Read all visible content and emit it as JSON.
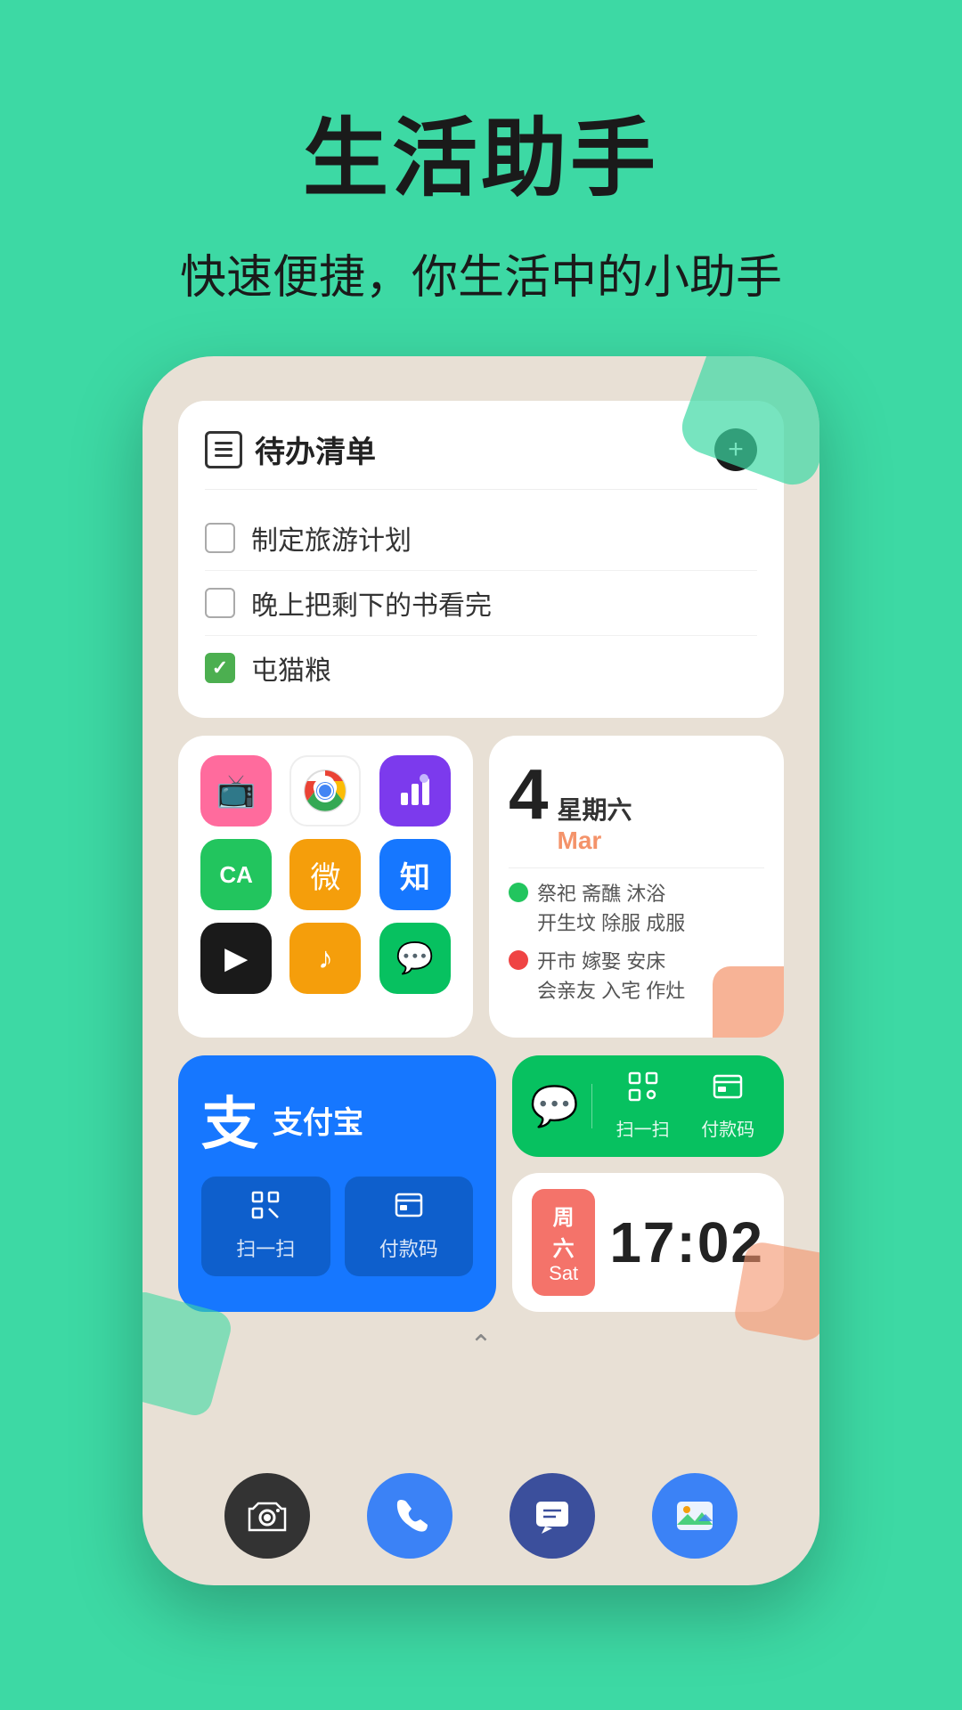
{
  "header": {
    "title": "生活助手",
    "subtitle": "快速便捷，你生活中的小助手"
  },
  "todo": {
    "title": "待办清单",
    "items": [
      {
        "text": "制定旅游计划",
        "checked": false
      },
      {
        "text": "晚上把剩下的书看完",
        "checked": false
      },
      {
        "text": "屯猫粮",
        "checked": true
      }
    ]
  },
  "apps": [
    {
      "name": "TV",
      "color": "pink",
      "emoji": "📺"
    },
    {
      "name": "Chrome",
      "color": "chrome",
      "emoji": ""
    },
    {
      "name": "Analytics",
      "color": "purple",
      "emoji": "📊"
    },
    {
      "name": "CA",
      "color": "green",
      "emoji": "CA"
    },
    {
      "name": "Weibo",
      "color": "orange",
      "emoji": "微"
    },
    {
      "name": "Zhihu",
      "color": "blue-know",
      "emoji": "知"
    },
    {
      "name": "TikTok",
      "color": "black",
      "emoji": "▶"
    },
    {
      "name": "Music",
      "color": "yellow-music",
      "emoji": "♪"
    },
    {
      "name": "WeChat",
      "color": "green-wechat",
      "emoji": "💬"
    }
  ],
  "calendar": {
    "date": "4",
    "weekday": "星期六",
    "month": "Mar",
    "good_events": "祭祀 斋醮 沐浴\n开生坟 除服 成服",
    "bad_events": "开市 嫁娶 安床\n会亲友 入宅 作灶"
  },
  "alipay": {
    "name": "支付宝",
    "logo": "支",
    "scan_label": "扫一扫",
    "pay_label": "付款码"
  },
  "wechat": {
    "scan_label": "扫一扫",
    "pay_label": "付款码"
  },
  "clock": {
    "weekday": "周六",
    "sat": "Sat",
    "time": "17:02"
  },
  "dock": {
    "camera_label": "相机",
    "phone_label": "电话",
    "message_label": "消息",
    "gallery_label": "相册"
  }
}
